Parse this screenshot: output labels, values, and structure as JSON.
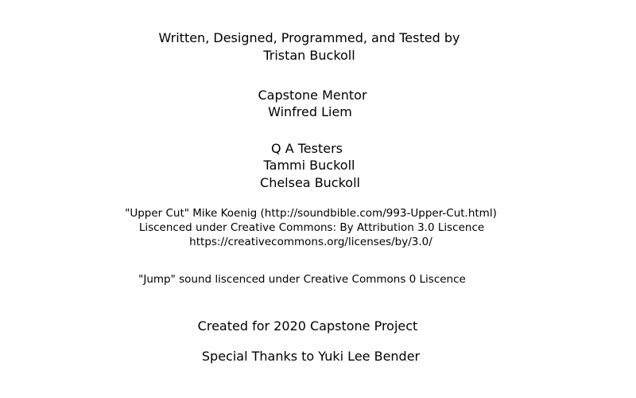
{
  "credits": {
    "role_writer": "Written, Designed, Programmed, and Tested by",
    "name_writer": "Tristan Buckoll",
    "role_mentor": "Capstone Mentor",
    "name_mentor": "Winfred Liem",
    "role_testers": "Q A Testers",
    "testers": [
      "Tammi Buckoll",
      "Chelsea Buckoll"
    ],
    "sound_upper_cut": "\"Upper Cut\" Mike Koenig (http://soundbible.com/993-Upper-Cut.html)",
    "sound_license": "Liscenced under Creative Commons: By Attribution 3.0 Liscence",
    "license_url": "https://creativecommons.org/licenses/by/3.0/",
    "sound_jump": "\"Jump\" sound liscenced under Creative Commons 0 Liscence",
    "project": "Created for 2020 Capstone Project",
    "thanks": "Special Thanks to Yuki Lee Bender"
  }
}
